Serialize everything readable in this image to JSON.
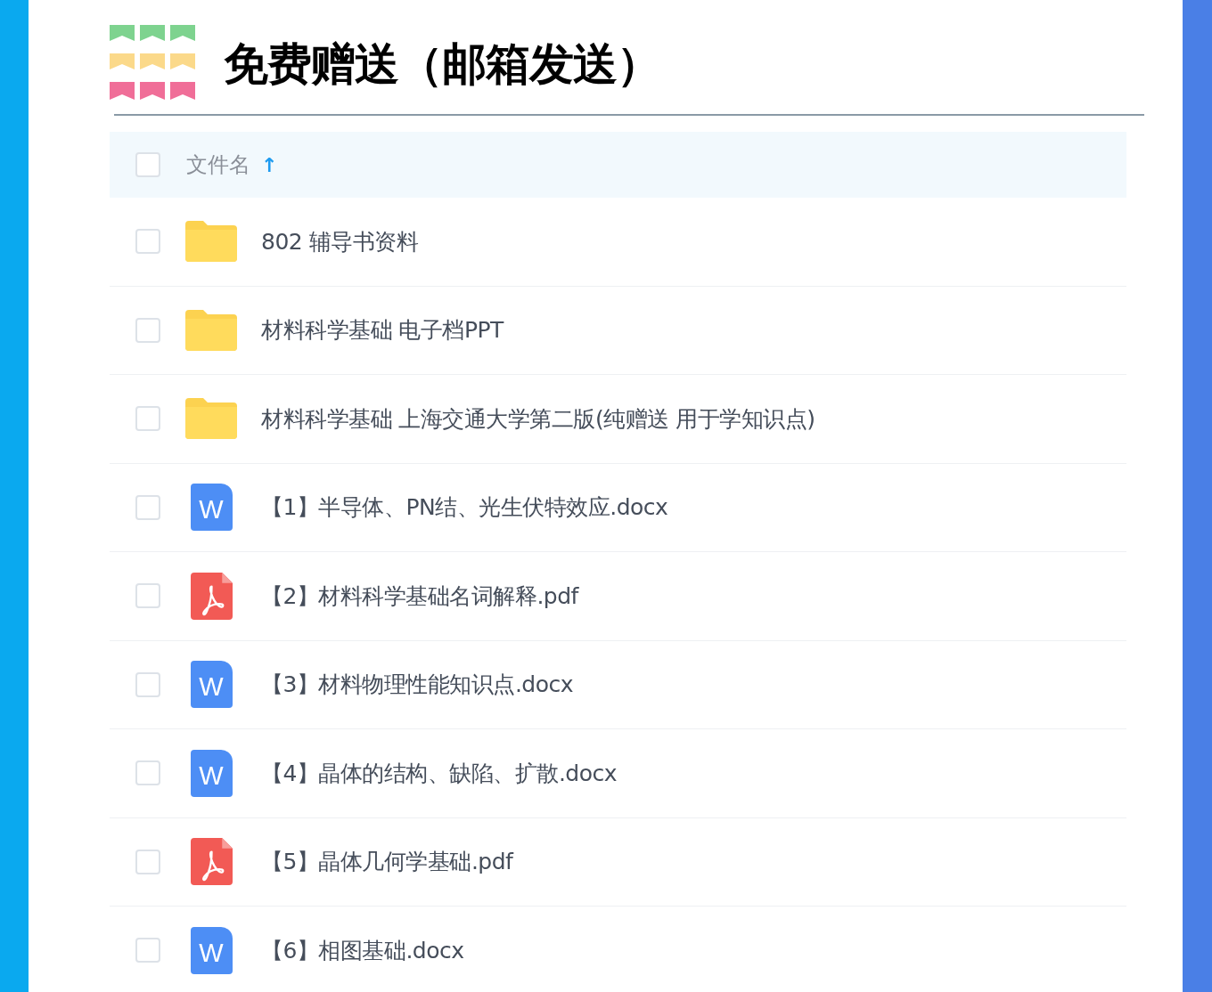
{
  "title": "免费赠送（邮箱发送）",
  "table": {
    "header": {
      "label": "文件名",
      "sort_icon": "↑",
      "checked": false
    },
    "rows": [
      {
        "kind": "folder",
        "name": "802 辅导书资料",
        "checked": false
      },
      {
        "kind": "folder",
        "name": "材料科学基础 电子档PPT",
        "checked": false
      },
      {
        "kind": "folder",
        "name": "材料科学基础 上海交通大学第二版(纯赠送 用于学知识点)",
        "checked": false
      },
      {
        "kind": "word",
        "icon_letter": "W",
        "name": "【1】半导体、PN结、光生伏特效应.docx",
        "checked": false
      },
      {
        "kind": "pdf",
        "name": "【2】材料科学基础名词解释.pdf",
        "checked": false
      },
      {
        "kind": "word",
        "icon_letter": "W",
        "name": "【3】材料物理性能知识点.docx",
        "checked": false
      },
      {
        "kind": "word",
        "icon_letter": "W",
        "name": "【4】晶体的结构、缺陷、扩散.docx",
        "checked": false
      },
      {
        "kind": "pdf",
        "name": "【5】晶体几何学基础.pdf",
        "checked": false
      },
      {
        "kind": "word",
        "icon_letter": "W",
        "name": "【6】相图基础.docx",
        "checked": false
      }
    ]
  }
}
